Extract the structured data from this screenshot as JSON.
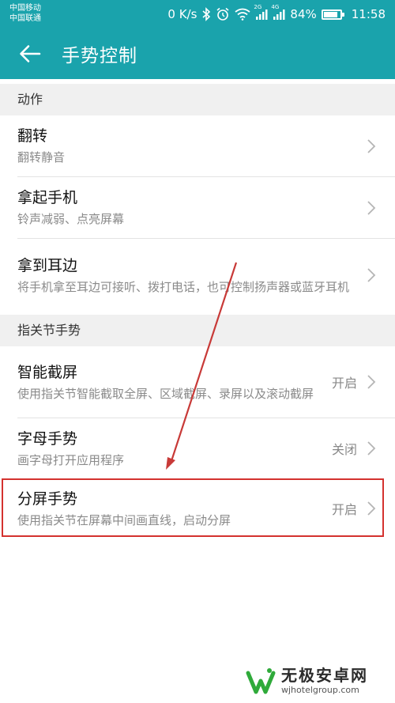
{
  "status_bar": {
    "carrier1": "中国移动",
    "carrier2": "中国联通",
    "network_speed": "0 K/s",
    "signal1_label": "2G",
    "signal2_label": "4G",
    "battery_percent": "84%",
    "battery_level": 0.84,
    "time": "11:58"
  },
  "toolbar": {
    "title": "手势控制"
  },
  "sections": [
    {
      "header": "动作",
      "items": [
        {
          "title": "翻转",
          "subtitle": "翻转静音",
          "status": ""
        },
        {
          "title": "拿起手机",
          "subtitle": "铃声减弱、点亮屏幕",
          "status": ""
        },
        {
          "title": "拿到耳边",
          "subtitle": "将手机拿至耳边可接听、拨打电话，也可控制扬声器或蓝牙耳机",
          "status": ""
        }
      ]
    },
    {
      "header": "指关节手势",
      "items": [
        {
          "title": "智能截屏",
          "subtitle": "使用指关节智能截取全屏、区域截屏、录屏以及滚动截屏",
          "status": "开启"
        },
        {
          "title": "字母手势",
          "subtitle": "画字母打开应用程序",
          "status": "关闭"
        },
        {
          "title": "分屏手势",
          "subtitle": "使用指关节在屏幕中间画直线，启动分屏",
          "status": "开启"
        }
      ]
    }
  ],
  "watermark": {
    "title": "无极安卓网",
    "url": "wjhotelgroup.com"
  },
  "colors": {
    "header_bg": "#1aa3ac",
    "section_bg": "#f0f0f0",
    "annotation_red": "#d4322f"
  }
}
